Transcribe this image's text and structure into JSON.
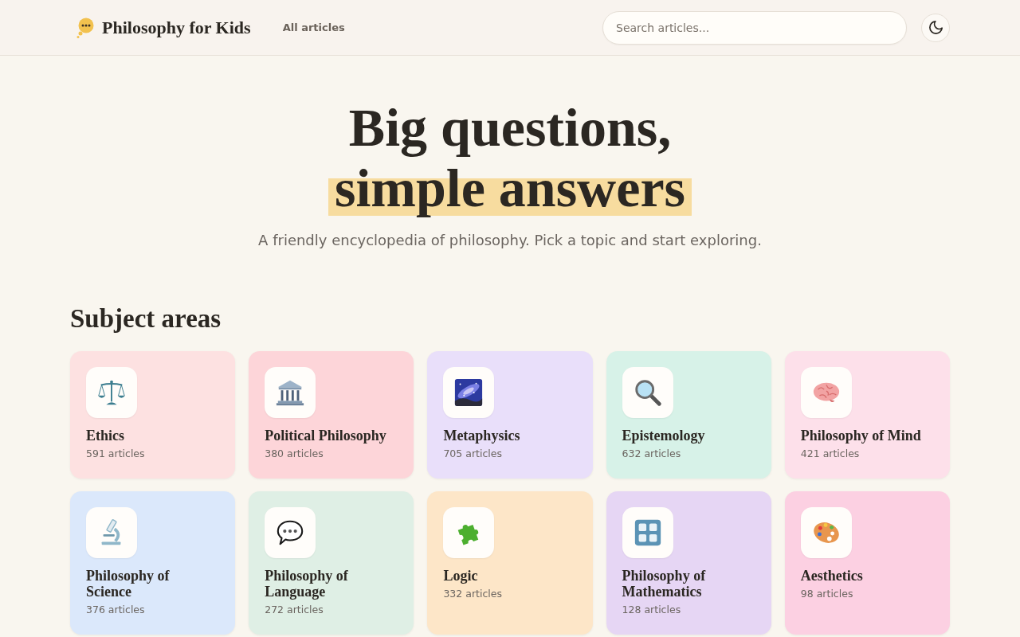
{
  "header": {
    "site_title": "Philosophy for Kids",
    "nav": [
      {
        "label": "All articles"
      }
    ],
    "search": {
      "placeholder": "Search articles..."
    }
  },
  "hero": {
    "title": "Big questions,",
    "highlight": "simple answers",
    "subtitle": "A friendly encyclopedia of philosophy. Pick a topic and start exploring."
  },
  "subjects": {
    "heading": "Subject areas",
    "cards": [
      {
        "title": "Ethics",
        "count": "591 articles",
        "color": "#fde1e1"
      },
      {
        "title": "Political Philosophy",
        "count": "380 articles",
        "color": "#fdd5d9"
      },
      {
        "title": "Metaphysics",
        "count": "705 articles",
        "color": "#e9dffa"
      },
      {
        "title": "Epistemology",
        "count": "632 articles",
        "color": "#d7f2e8"
      },
      {
        "title": "Philosophy of Mind",
        "count": "421 articles",
        "color": "#fde0ea"
      },
      {
        "title": "Philosophy of Science",
        "count": "376 articles",
        "color": "#dbe8fb"
      },
      {
        "title": "Philosophy of Language",
        "count": "272 articles",
        "color": "#dfefe5"
      },
      {
        "title": "Logic",
        "count": "332 articles",
        "color": "#fde6c8"
      },
      {
        "title": "Philosophy of Mathematics",
        "count": "128 articles",
        "color": "#e6d6f4"
      },
      {
        "title": "Aesthetics",
        "count": "98 articles",
        "color": "#fcd0e2"
      }
    ]
  }
}
